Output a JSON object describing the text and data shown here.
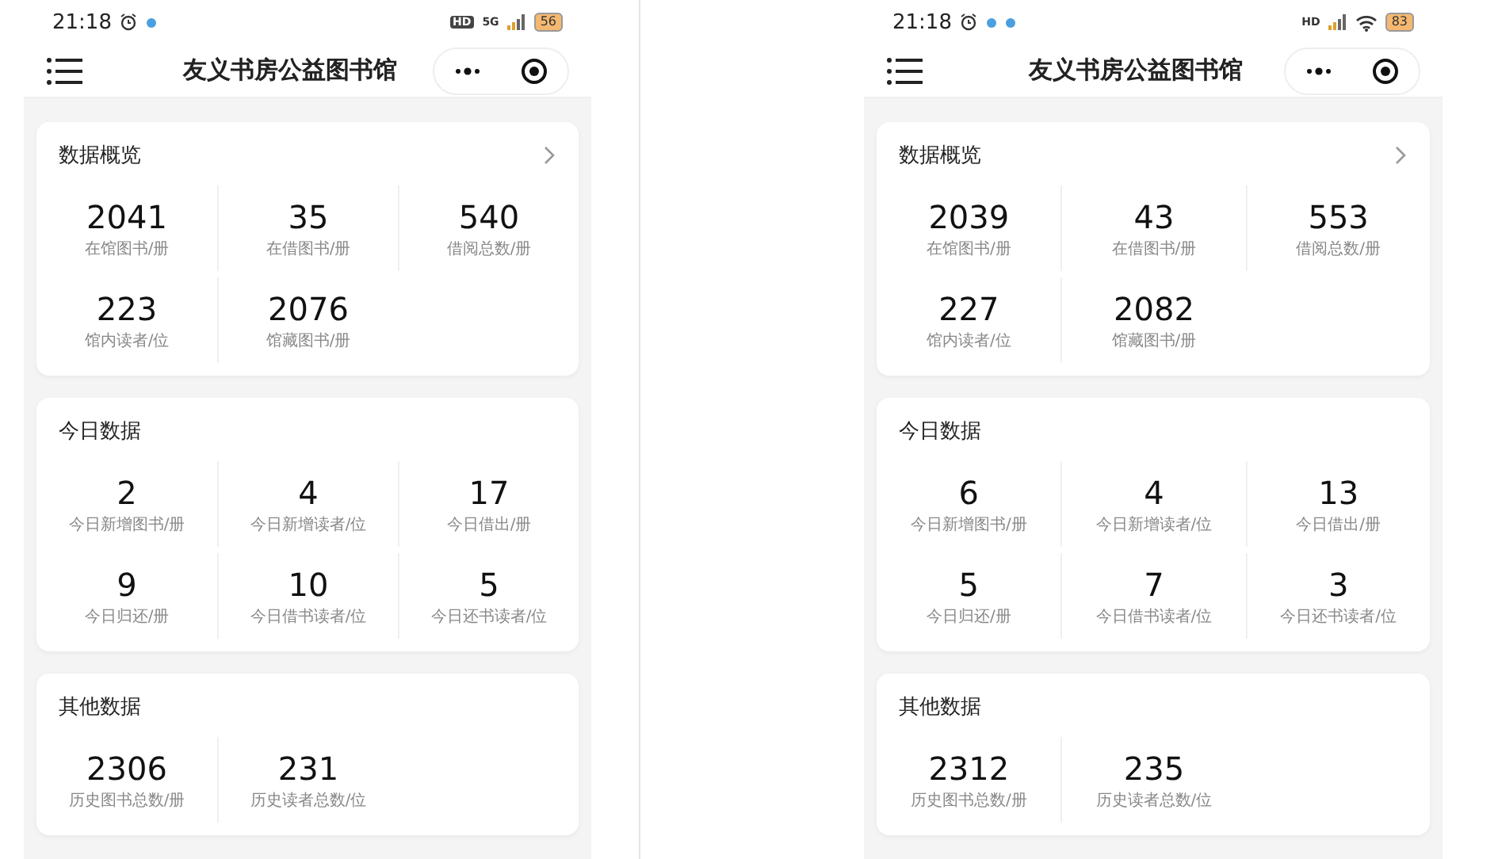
{
  "phones": [
    {
      "status_bar": {
        "time": "21:18",
        "left_icons": [
          {
            "kind": "alarm"
          },
          {
            "kind": "dot"
          }
        ],
        "right_items": [
          {
            "kind": "hd-badge",
            "text": "HD"
          },
          {
            "kind": "signal",
            "text": "5G"
          },
          {
            "kind": "battery",
            "text": "56"
          }
        ]
      },
      "header": {
        "title": "友义书房公益图书馆"
      },
      "cards": [
        {
          "title": "数据概览",
          "has_arrow": true,
          "stats": [
            {
              "value": "2041",
              "label": "在馆图书/册"
            },
            {
              "value": "35",
              "label": "在借图书/册"
            },
            {
              "value": "540",
              "label": "借阅总数/册"
            },
            {
              "value": "223",
              "label": "馆内读者/位"
            },
            {
              "value": "2076",
              "label": "馆藏图书/册"
            }
          ]
        },
        {
          "title": "今日数据",
          "has_arrow": false,
          "stats": [
            {
              "value": "2",
              "label": "今日新增图书/册"
            },
            {
              "value": "4",
              "label": "今日新增读者/位"
            },
            {
              "value": "17",
              "label": "今日借出/册"
            },
            {
              "value": "9",
              "label": "今日归还/册"
            },
            {
              "value": "10",
              "label": "今日借书读者/位"
            },
            {
              "value": "5",
              "label": "今日还书读者/位"
            }
          ]
        },
        {
          "title": "其他数据",
          "has_arrow": false,
          "stats": [
            {
              "value": "2306",
              "label": "历史图书总数/册"
            },
            {
              "value": "231",
              "label": "历史读者总数/位"
            }
          ]
        }
      ]
    },
    {
      "status_bar": {
        "time": "21:18",
        "left_icons": [
          {
            "kind": "alarm"
          },
          {
            "kind": "dot"
          },
          {
            "kind": "dot"
          }
        ],
        "right_items": [
          {
            "kind": "signal",
            "text": "HD"
          },
          {
            "kind": "wifi"
          },
          {
            "kind": "battery",
            "text": "83"
          }
        ]
      },
      "header": {
        "title": "友义书房公益图书馆"
      },
      "cards": [
        {
          "title": "数据概览",
          "has_arrow": true,
          "stats": [
            {
              "value": "2039",
              "label": "在馆图书/册"
            },
            {
              "value": "43",
              "label": "在借图书/册"
            },
            {
              "value": "553",
              "label": "借阅总数/册"
            },
            {
              "value": "227",
              "label": "馆内读者/位"
            },
            {
              "value": "2082",
              "label": "馆藏图书/册"
            }
          ]
        },
        {
          "title": "今日数据",
          "has_arrow": false,
          "stats": [
            {
              "value": "6",
              "label": "今日新增图书/册"
            },
            {
              "value": "4",
              "label": "今日新增读者/位"
            },
            {
              "value": "13",
              "label": "今日借出/册"
            },
            {
              "value": "5",
              "label": "今日归还/册"
            },
            {
              "value": "7",
              "label": "今日借书读者/位"
            },
            {
              "value": "3",
              "label": "今日还书读者/位"
            }
          ]
        },
        {
          "title": "其他数据",
          "has_arrow": false,
          "stats": [
            {
              "value": "2312",
              "label": "历史图书总数/册"
            },
            {
              "value": "235",
              "label": "历史读者总数/位"
            }
          ]
        }
      ]
    }
  ]
}
